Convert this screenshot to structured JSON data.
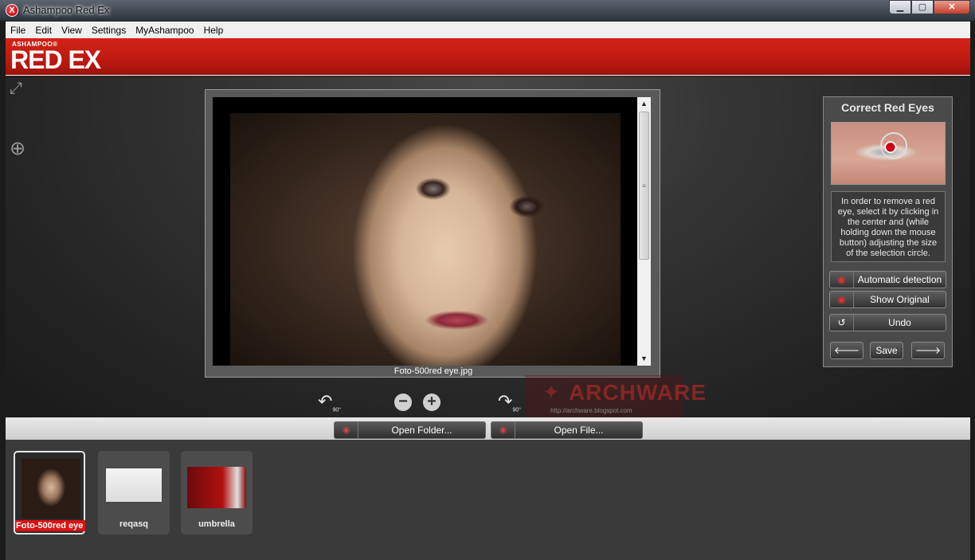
{
  "window": {
    "title": "Ashampoo Red Ex",
    "app_icon": "X"
  },
  "menu": [
    "File",
    "Edit",
    "View",
    "Settings",
    "MyAshampoo",
    "Help"
  ],
  "brand": {
    "small": "ASHAMPOO®",
    "big": "RED EX"
  },
  "image": {
    "filename": "Foto-500red eye.jpg"
  },
  "controls": {
    "rotate_left": "90°",
    "rotate_right": "90°",
    "zoom_out": "−",
    "zoom_in": "+"
  },
  "watermark": {
    "text": "ARCHWARE",
    "url": "http://archware.blogspot.com"
  },
  "panel": {
    "title": "Correct Red Eyes",
    "help": "In order to remove a red eye, select it by clicking in the center and (while holding down the mouse button) adjusting the size of the selection circle.",
    "auto_detection": "Automatic detection",
    "show_original": "Show Original",
    "undo": "Undo",
    "save": "Save",
    "prev": "🡐",
    "next": "🡒"
  },
  "strip": {
    "open_folder": "Open Folder...",
    "open_file": "Open File..."
  },
  "thumbnails": [
    {
      "label": "Foto-500red eye",
      "selected": true
    },
    {
      "label": "reqasq",
      "selected": false
    },
    {
      "label": "umbrella",
      "selected": false
    }
  ],
  "colors": {
    "brand_red": "#c41e13",
    "panel_bg": "#4a4a4a"
  }
}
